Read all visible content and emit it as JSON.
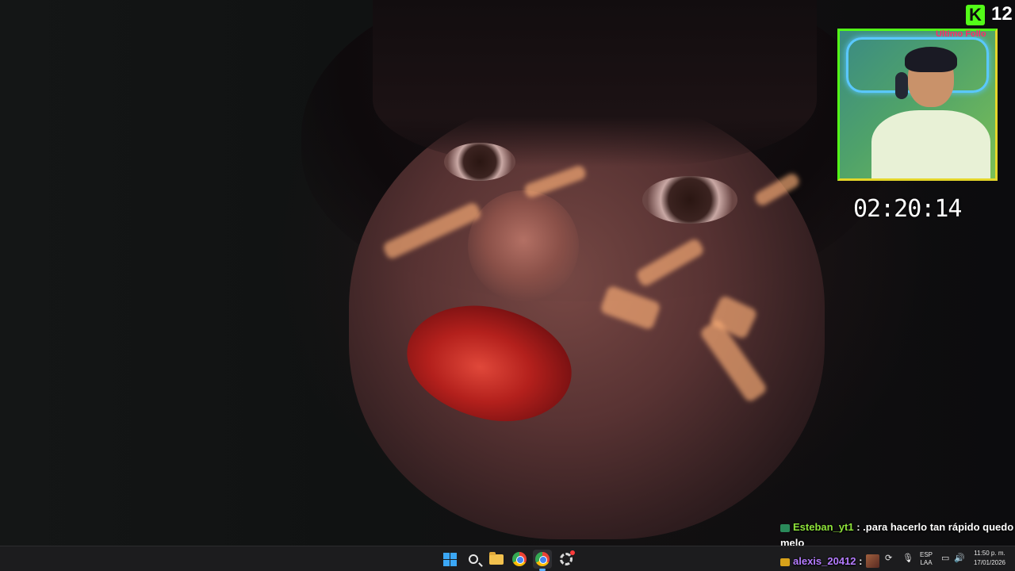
{
  "stream_overlay": {
    "platform_badge": "K",
    "viewer_count": "12",
    "last_follow_label": "Ultimo Follo",
    "timer": "02:20:14"
  },
  "chat": [
    {
      "user": "Esteban_yt1",
      "separator": " : ",
      "message": ".para hacerlo tan rápido quedo",
      "continuation": "melo",
      "user_color": "#8ee33a"
    },
    {
      "user": "alexis_20412",
      "separator": " :",
      "message": "",
      "user_color": "#b57cff"
    }
  ],
  "taskbar": {
    "pinned": [
      {
        "name": "start-button",
        "label": "Start"
      },
      {
        "name": "search-button",
        "label": "Search"
      },
      {
        "name": "file-explorer",
        "label": "File Explorer"
      },
      {
        "name": "chrome",
        "label": "Google Chrome"
      },
      {
        "name": "chrome-active",
        "label": "Google Chrome"
      },
      {
        "name": "settings",
        "label": "Settings"
      }
    ],
    "tray": {
      "language_line1": "ESP",
      "language_line2": "LAA",
      "time": "11:50 p. m.",
      "date": "17/01/2026"
    }
  },
  "colors": {
    "kick_green": "#53fc18",
    "taskbar_bg": "#1c1c1e",
    "accent_blue": "#3ba7f5"
  }
}
